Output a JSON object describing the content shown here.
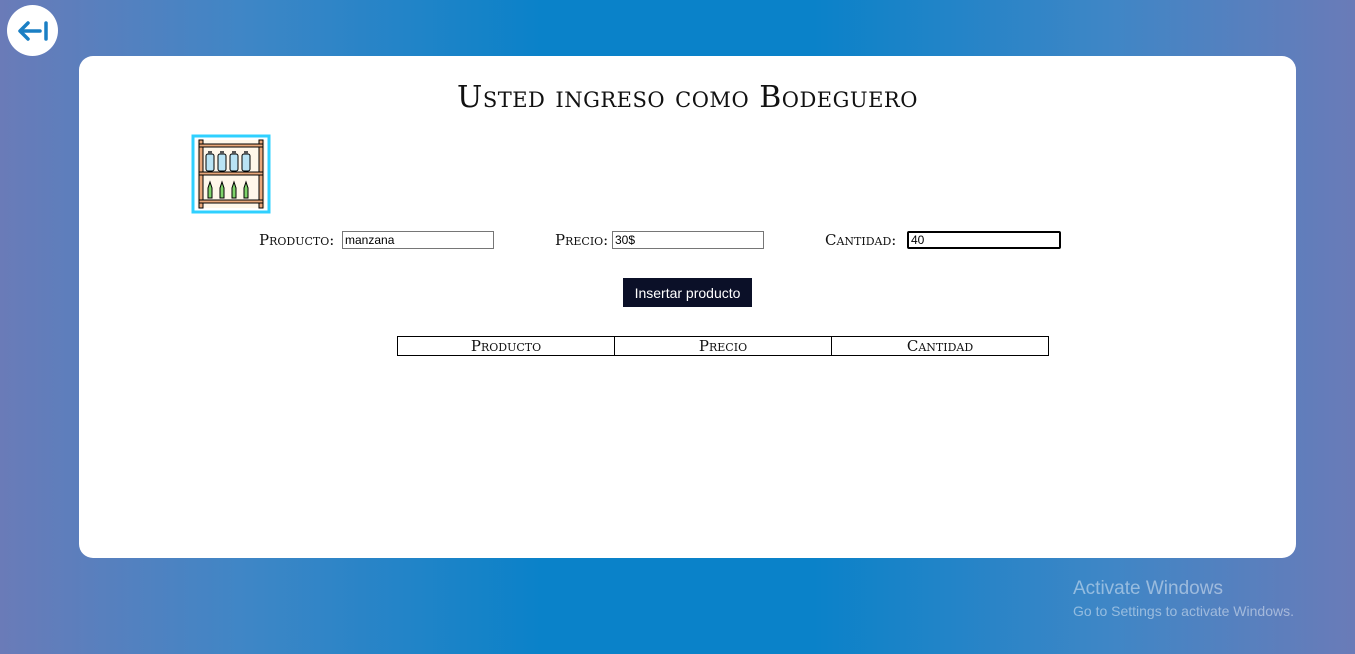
{
  "page": {
    "title": "Usted ingreso como Bodeguero"
  },
  "back_button": {
    "icon": "arrow-left-to-bar-icon",
    "color": "#1a7fc4"
  },
  "form": {
    "producto_label": "Producto:",
    "producto_value": "manzana",
    "precio_label": "Precio:",
    "precio_value": "30$",
    "cantidad_label": "Cantidad:",
    "cantidad_value": "40",
    "submit_label": "Insertar producto"
  },
  "table": {
    "headers": [
      "Producto",
      "Precio",
      "Cantidad"
    ],
    "rows": []
  },
  "watermark": {
    "line1": "Activate Windows",
    "line2": "Go to Settings to activate Windows."
  },
  "colors": {
    "background": "#0a82c9",
    "button": "#0b1028",
    "card": "#ffffff"
  }
}
